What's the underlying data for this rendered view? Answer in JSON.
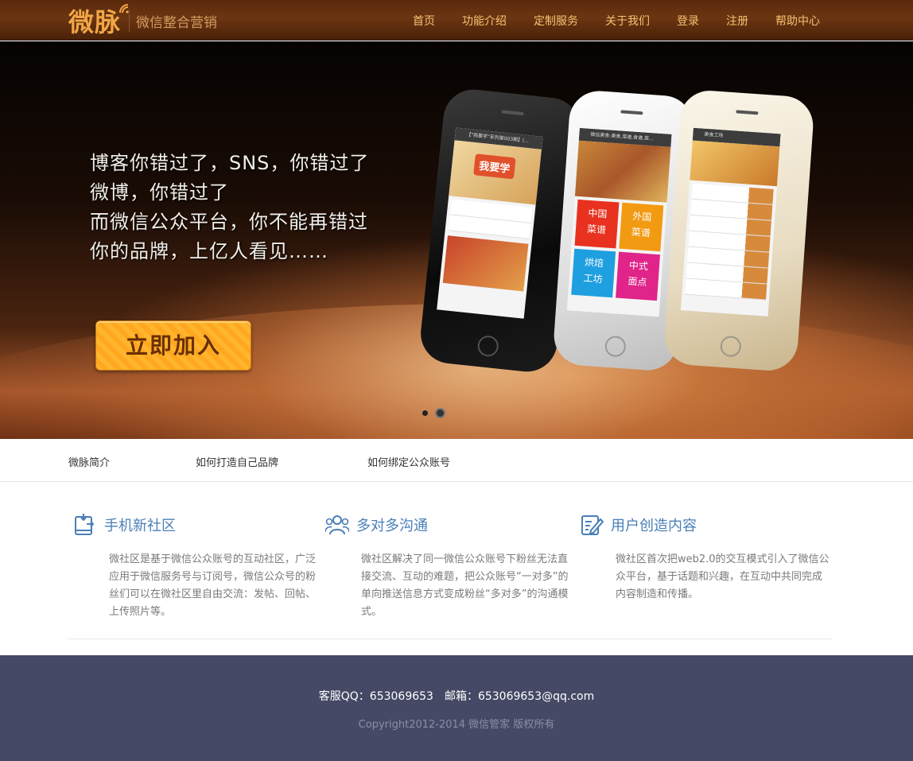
{
  "header": {
    "logo_text": "微脉",
    "tagline": "微信整合营销",
    "nav": [
      "首页",
      "功能介绍",
      "定制服务",
      "关于我们",
      "登录",
      "注册",
      "帮助中心"
    ]
  },
  "banner": {
    "lines": [
      "博客你错过了，SNS，你错过了",
      "微博，你错过了",
      "而微信公众平台，你不能再错过",
      "你的品牌，上亿人看见……"
    ],
    "join_label": "立即加入",
    "phone1": {
      "bar": "【\"我要学\"系列第003期】(...",
      "banner_text": "我要学"
    },
    "phone2": {
      "bar": "微信美食-美食,菜谱,食谱,菜...",
      "tiles": [
        "中国\n菜谱",
        "外国\n菜谱",
        "烘焙\n工坊",
        "中式\n面点"
      ]
    },
    "phone3": {
      "bar": "美食工场"
    }
  },
  "subnav": [
    "微脉简介",
    "如何打造自己品牌",
    "如何绑定公众账号"
  ],
  "features": [
    {
      "title": "手机新社区",
      "icon": "mobile-icon",
      "text": "微社区是基于微信公众账号的互动社区，广泛应用于微信服务号与订阅号，微信公众号的粉丝们可以在微社区里自由交流：发帖、回帖、上传照片等。"
    },
    {
      "title": "多对多沟通",
      "icon": "users-icon",
      "text": "微社区解决了同一微信公众账号下粉丝无法直接交流、互动的难题，把公众账号“一对多”的单向推送信息方式变成粉丝“多对多”的沟通模式。"
    },
    {
      "title": "用户创造内容",
      "icon": "edit-icon",
      "text": "微社区首次把web2.0的交互模式引入了微信公众平台，基于话题和兴趣，在互动中共同完成内容制造和传播。"
    }
  ],
  "footer": {
    "contact": "客服QQ：653069653　邮箱：653069653@qq.com",
    "copyright": "Copyright2012-2014 微信管家 版权所有"
  },
  "colors": {
    "header_bg": "#5a2a0c",
    "nav_text": "#f7c070",
    "accent_blue": "#4a7fb8",
    "footer_bg": "#454965",
    "join_button": "#ffb52d"
  }
}
